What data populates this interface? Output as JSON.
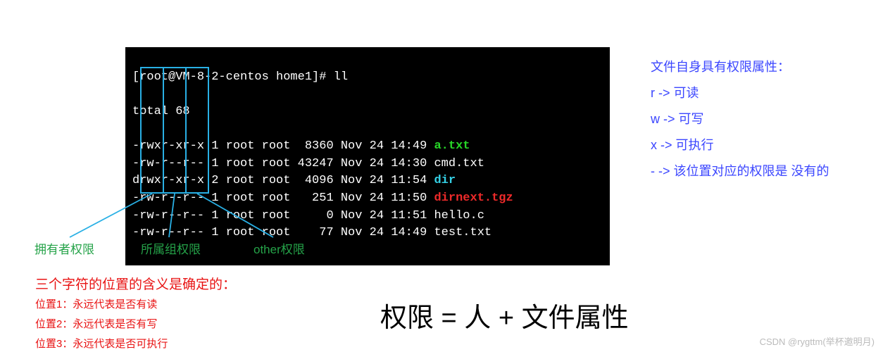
{
  "terminal": {
    "prompt": "[root@VM-8-2-centos home1]# ll",
    "total": "total 68",
    "rows": [
      {
        "perm": "-rwxr-xr-x",
        "nl": "1",
        "usr": "root",
        "grp": "root",
        "size": " 8360",
        "date": "Nov 24 14:49",
        "name": "a.txt",
        "cls": "t-green"
      },
      {
        "perm": "-rw-r--r--",
        "nl": "1",
        "usr": "root",
        "grp": "root",
        "size": "43247",
        "date": "Nov 24 14:30",
        "name": "cmd.txt",
        "cls": ""
      },
      {
        "perm": "drwxr-xr-x",
        "nl": "2",
        "usr": "root",
        "grp": "root",
        "size": " 4096",
        "date": "Nov 24 11:54",
        "name": "dir",
        "cls": "t-cyan"
      },
      {
        "perm": "-rw-r--r--",
        "nl": "1",
        "usr": "root",
        "grp": "root",
        "size": "  251",
        "date": "Nov 24 11:50",
        "name": "dirnext.tgz",
        "cls": "t-red"
      },
      {
        "perm": "-rw-r--r--",
        "nl": "1",
        "usr": "root",
        "grp": "root",
        "size": "    0",
        "date": "Nov 24 11:51",
        "name": "hello.c",
        "cls": ""
      },
      {
        "perm": "-rw-r--r--",
        "nl": "1",
        "usr": "root",
        "grp": "root",
        "size": "   77",
        "date": "Nov 24 14:49",
        "name": "test.txt",
        "cls": ""
      }
    ]
  },
  "side": {
    "title": "文件自身具有权限属性：",
    "r": "r  ->   可读",
    "w": "w ->   可写",
    "x": "x  ->   可执行",
    "dash": "-  ->   该位置对应的权限是 没有的"
  },
  "labels": {
    "owner": "拥有者权限",
    "group": "所属组权限",
    "other": "other权限"
  },
  "redblock": {
    "title": "三个字符的位置的含义是确定的：",
    "l1": "位置1：永远代表是否有读",
    "l2": "位置2：永远代表是否有写",
    "l3": "位置3：永远代表是否可执行"
  },
  "equation": "权限 = 人 + 文件属性",
  "watermark": "CSDN @rygttm(举杯邀明月)"
}
